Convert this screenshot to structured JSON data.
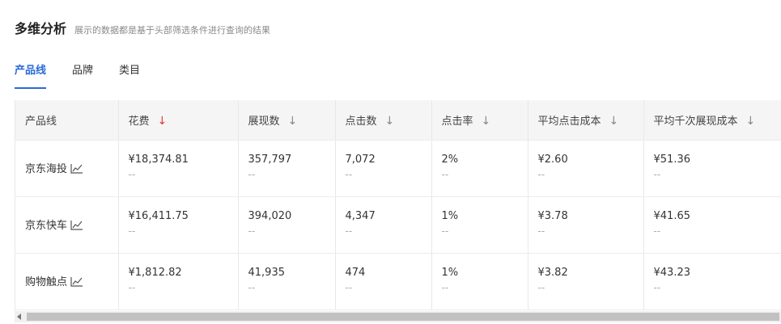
{
  "header": {
    "title": "多维分析",
    "subtitle": "展示的数据都是基于头部筛选条件进行查询的结果"
  },
  "tabs": [
    {
      "label": "产品线",
      "active": true
    },
    {
      "label": "品牌",
      "active": false
    },
    {
      "label": "类目",
      "active": false
    }
  ],
  "table": {
    "columns": [
      {
        "label": "产品线",
        "sort": ""
      },
      {
        "label": "花费",
        "sort": "↓"
      },
      {
        "label": "展现数",
        "sort": "↓"
      },
      {
        "label": "点击数",
        "sort": "↓"
      },
      {
        "label": "点击率",
        "sort": "↓"
      },
      {
        "label": "平均点击成本",
        "sort": "↓"
      },
      {
        "label": "平均千次展现成本",
        "sort": "↓"
      }
    ],
    "rows": [
      {
        "name": "京东海投",
        "cells": [
          {
            "value": "¥18,374.81",
            "sub": "--"
          },
          {
            "value": "357,797",
            "sub": "--"
          },
          {
            "value": "7,072",
            "sub": "--"
          },
          {
            "value": "2%",
            "sub": "--"
          },
          {
            "value": "¥2.60",
            "sub": "--"
          },
          {
            "value": "¥51.36",
            "sub": "--"
          }
        ]
      },
      {
        "name": "京东快车",
        "cells": [
          {
            "value": "¥16,411.75",
            "sub": "--"
          },
          {
            "value": "394,020",
            "sub": "--"
          },
          {
            "value": "4,347",
            "sub": "--"
          },
          {
            "value": "1%",
            "sub": "--"
          },
          {
            "value": "¥3.78",
            "sub": "--"
          },
          {
            "value": "¥41.65",
            "sub": "--"
          }
        ]
      },
      {
        "name": "购物触点",
        "cells": [
          {
            "value": "¥1,812.82",
            "sub": "--"
          },
          {
            "value": "41,935",
            "sub": "--"
          },
          {
            "value": "474",
            "sub": "--"
          },
          {
            "value": "1%",
            "sub": "--"
          },
          {
            "value": "¥3.82",
            "sub": "--"
          },
          {
            "value": "¥43.23",
            "sub": "--"
          }
        ]
      }
    ]
  },
  "colors": {
    "accent": "#2a6bd8",
    "sort_active": "#e03b3b",
    "header_bg": "#f5f5f5"
  }
}
